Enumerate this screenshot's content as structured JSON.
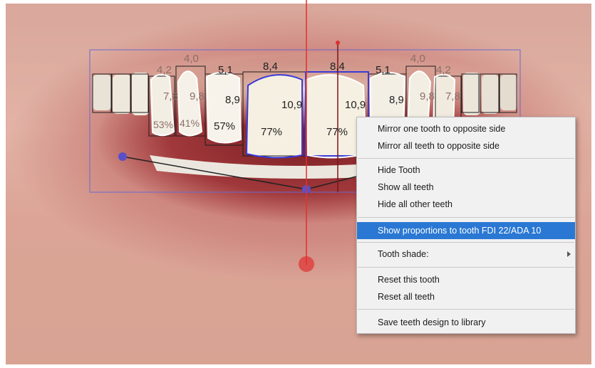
{
  "measurements": {
    "widths_top": [
      "4,0",
      "4,0"
    ],
    "widths": [
      "4,2",
      "5,1",
      "8,4",
      "8,4",
      "5,1",
      "4,2"
    ],
    "heights": [
      "7,8",
      "9,8",
      "8,9",
      "10,9",
      "10,9",
      "8,9",
      "9,8",
      "7,8"
    ],
    "proportions": [
      "53%",
      "41%",
      "57%",
      "77%",
      "77%"
    ]
  },
  "context_menu": {
    "items": [
      {
        "label": "Mirror one tooth to opposite side"
      },
      {
        "label": "Mirror all teeth to opposite side"
      },
      {
        "label": "Hide Tooth"
      },
      {
        "label": "Show all teeth"
      },
      {
        "label": "Hide all other teeth"
      },
      {
        "label": "Show proportions to tooth FDI 22/ADA 10",
        "highlighted": true
      },
      {
        "label": "Tooth shade:",
        "submenu": true
      },
      {
        "label": "Reset this tooth"
      },
      {
        "label": "Reset all teeth"
      },
      {
        "label": "Save teeth design to library"
      }
    ]
  },
  "colors": {
    "midline": "#e03030",
    "tooth_outline_selected": "#3a3ad8",
    "frame": "#6a6ad0",
    "menu_highlight": "#2a78d3"
  }
}
